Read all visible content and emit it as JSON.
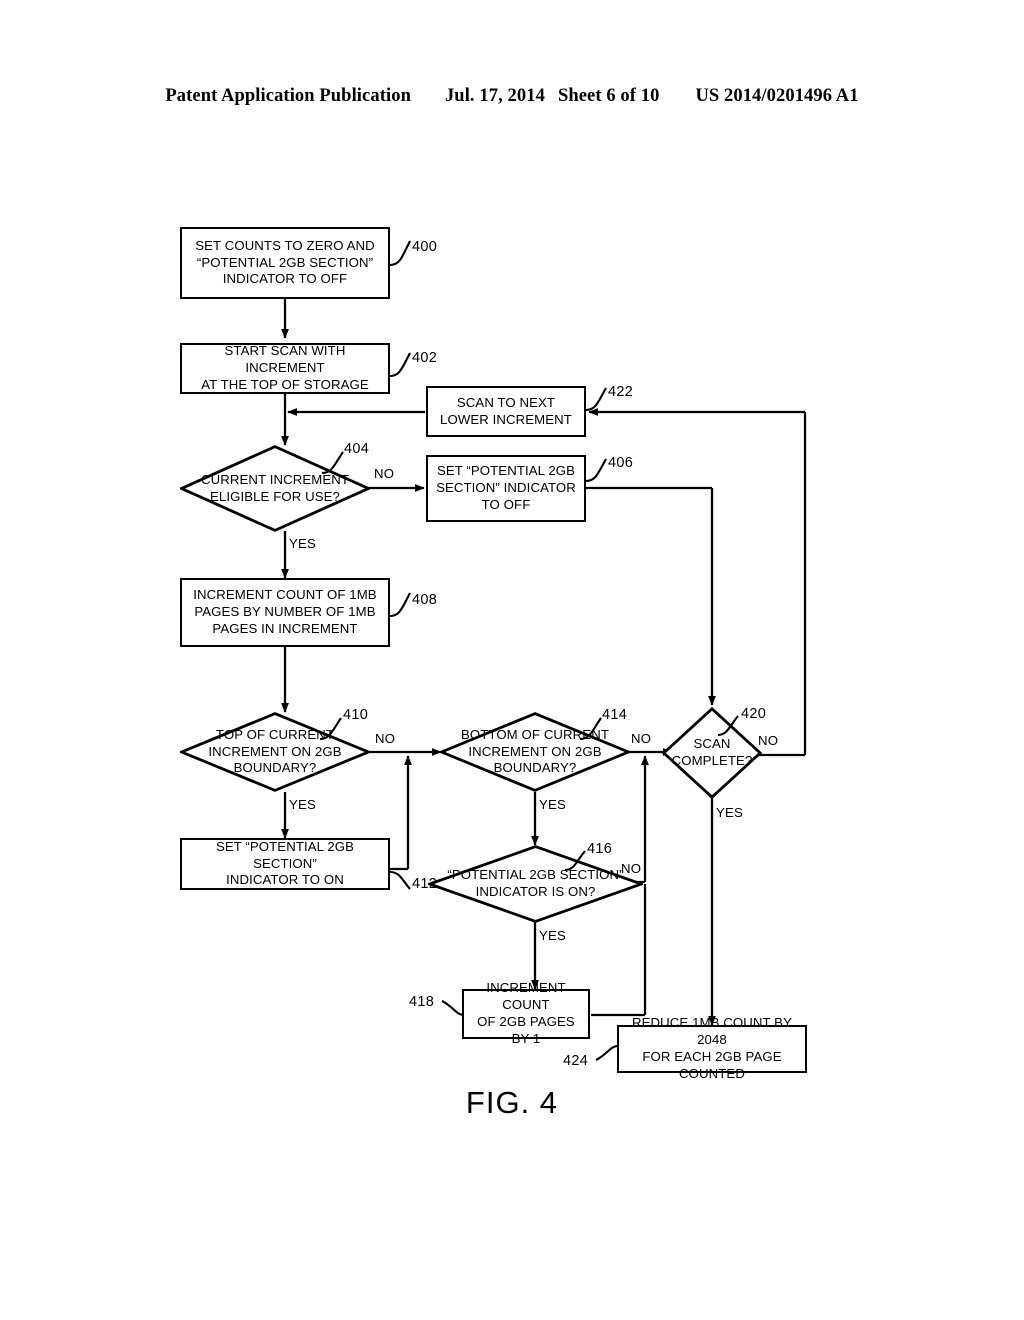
{
  "header": {
    "publication": "Patent Application Publication",
    "date": "Jul. 17, 2014",
    "sheet": "Sheet 6 of 10",
    "patent_number": "US 2014/0201496 A1"
  },
  "figure": {
    "caption": "FIG. 4",
    "nodes": [
      {
        "ref": "400",
        "type": "process",
        "lines": [
          "SET COUNTS TO ZERO AND",
          "“POTENTIAL 2GB SECTION”",
          "INDICATOR TO OFF"
        ]
      },
      {
        "ref": "402",
        "type": "process",
        "lines": [
          "START SCAN WITH INCREMENT",
          "AT THE TOP OF STORAGE"
        ]
      },
      {
        "ref": "422",
        "type": "process",
        "lines": [
          "SCAN TO NEXT",
          "LOWER INCREMENT"
        ]
      },
      {
        "ref": "404",
        "type": "decision",
        "lines": [
          "CURRENT",
          "INCREMENT ELIGIBLE",
          "FOR USE?"
        ]
      },
      {
        "ref": "406",
        "type": "process",
        "lines": [
          "SET “POTENTIAL 2GB",
          "SECTION” INDICATOR",
          "TO OFF"
        ]
      },
      {
        "ref": "408",
        "type": "process",
        "lines": [
          "INCREMENT COUNT OF 1MB",
          "PAGES BY NUMBER OF 1MB",
          "PAGES IN INCREMENT"
        ]
      },
      {
        "ref": "410",
        "type": "decision",
        "lines": [
          "TOP OF",
          "CURRENT INCREMENT",
          "ON 2GB BOUNDARY?"
        ]
      },
      {
        "ref": "414",
        "type": "decision",
        "lines": [
          "BOTTOM OF",
          "CURRENT INCREMENT",
          "ON 2GB BOUNDARY?"
        ]
      },
      {
        "ref": "420",
        "type": "decision",
        "lines": [
          "SCAN",
          "COMPLETE?"
        ]
      },
      {
        "ref": "412",
        "type": "process",
        "lines": [
          "SET “POTENTIAL 2GB SECTION”",
          "INDICATOR TO ON"
        ]
      },
      {
        "ref": "416",
        "type": "decision",
        "lines": [
          "“POTENTIAL",
          "2GB SECTION” INDICATOR",
          "IS ON?"
        ]
      },
      {
        "ref": "418",
        "type": "process",
        "lines": [
          "INCREMENT COUNT",
          "OF 2GB PAGES BY 1"
        ]
      },
      {
        "ref": "424",
        "type": "process",
        "lines": [
          "REDUCE 1MB COUNT BY 2048",
          "FOR EACH 2GB PAGE COUNTED"
        ]
      }
    ],
    "branch_labels": {
      "n404_no": "NO",
      "n404_yes": "YES",
      "n410_no": "NO",
      "n410_yes": "YES",
      "n414_no": "NO",
      "n414_yes": "YES",
      "n416_no": "NO",
      "n416_yes": "YES",
      "n420_no": "NO",
      "n420_yes": "YES"
    }
  },
  "colors": {
    "ink": "#000000",
    "paper": "#ffffff"
  }
}
